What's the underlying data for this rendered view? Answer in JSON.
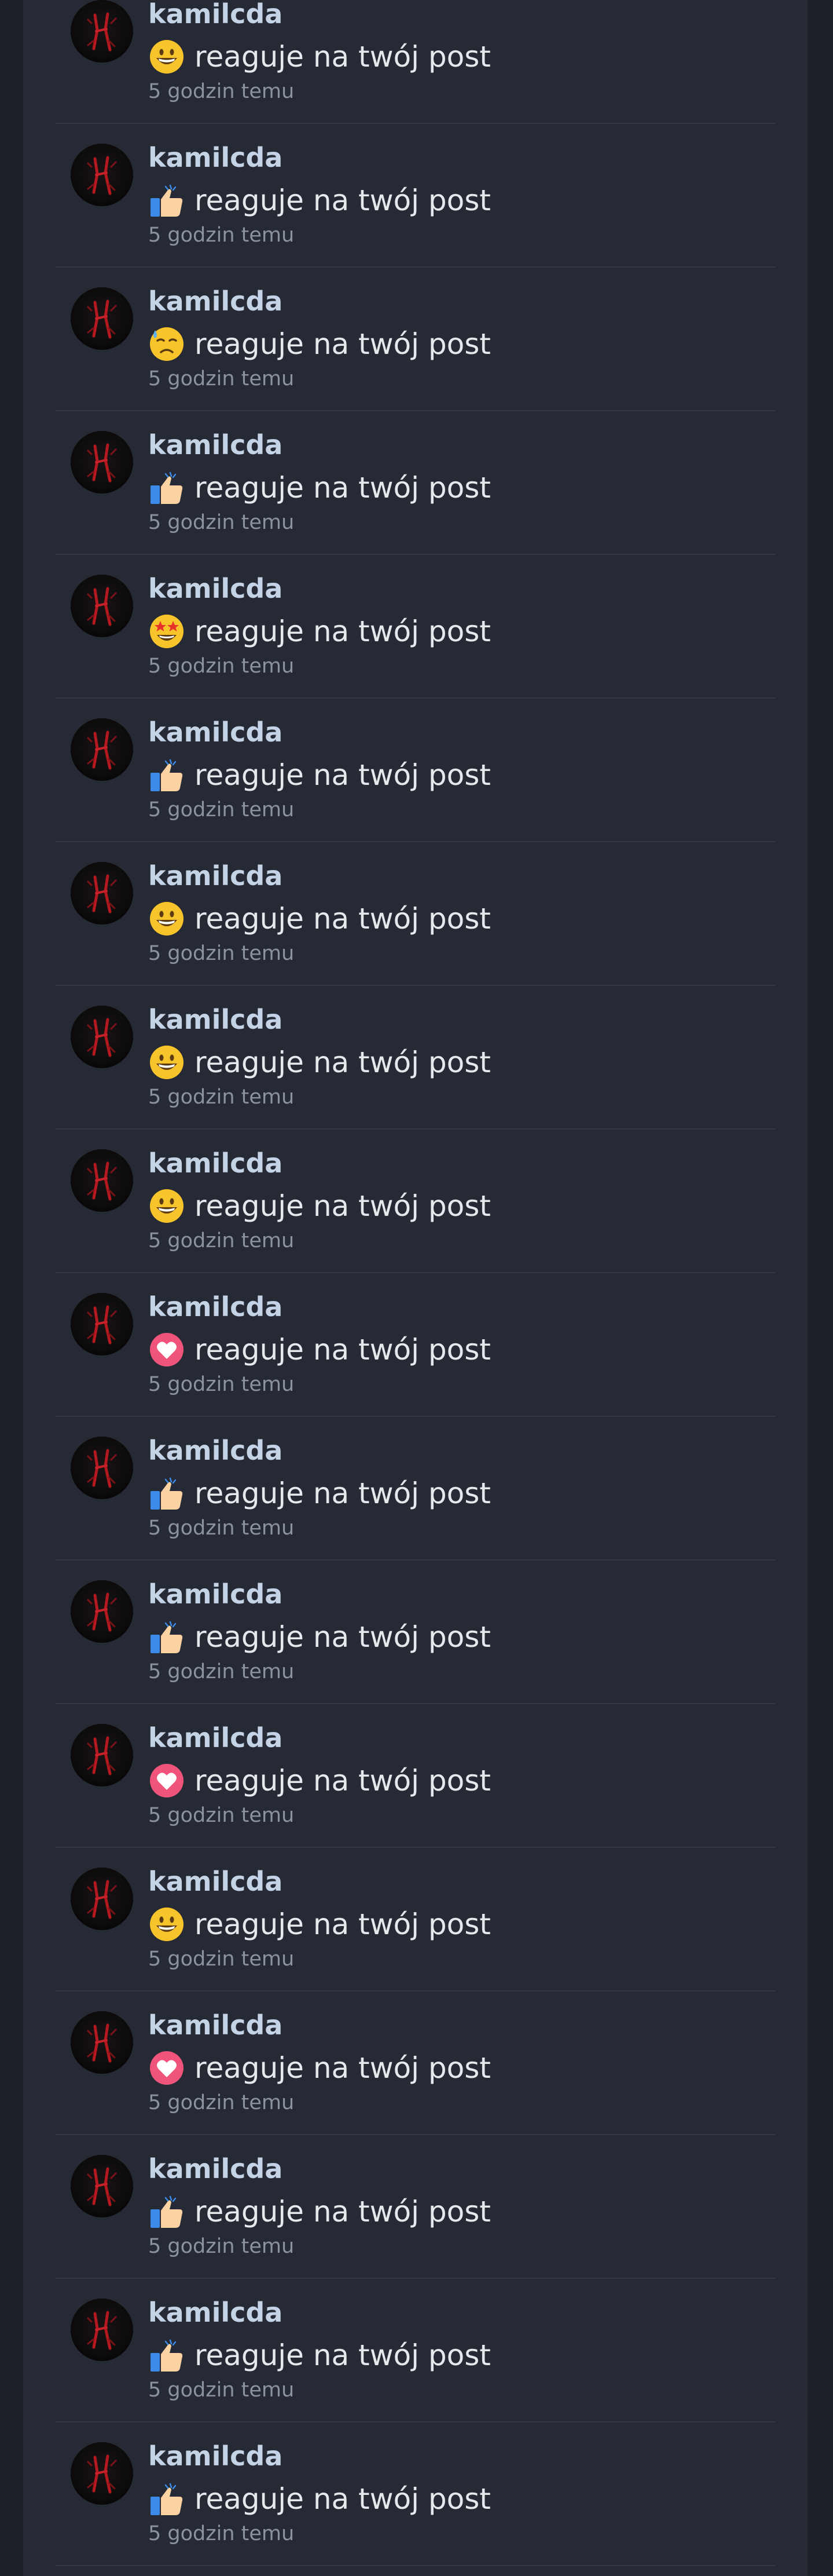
{
  "notifications": [
    {
      "user": "kamilcda",
      "reaction": "grinning-face-icon",
      "action": "reaguje na twój post",
      "time": "5 godzin temu"
    },
    {
      "user": "kamilcda",
      "reaction": "thumbs-up-icon",
      "action": "reaguje na twój post",
      "time": "5 godzin temu"
    },
    {
      "user": "kamilcda",
      "reaction": "sad-face-icon",
      "action": "reaguje na twój post",
      "time": "5 godzin temu"
    },
    {
      "user": "kamilcda",
      "reaction": "thumbs-up-icon",
      "action": "reaguje na twój post",
      "time": "5 godzin temu"
    },
    {
      "user": "kamilcda",
      "reaction": "star-struck-icon",
      "action": "reaguje na twój post",
      "time": "5 godzin temu"
    },
    {
      "user": "kamilcda",
      "reaction": "thumbs-up-icon",
      "action": "reaguje na twój post",
      "time": "5 godzin temu"
    },
    {
      "user": "kamilcda",
      "reaction": "grinning-face-icon",
      "action": "reaguje na twój post",
      "time": "5 godzin temu"
    },
    {
      "user": "kamilcda",
      "reaction": "grinning-face-icon",
      "action": "reaguje na twój post",
      "time": "5 godzin temu"
    },
    {
      "user": "kamilcda",
      "reaction": "grinning-face-icon",
      "action": "reaguje na twój post",
      "time": "5 godzin temu"
    },
    {
      "user": "kamilcda",
      "reaction": "heart-icon",
      "action": "reaguje na twój post",
      "time": "5 godzin temu"
    },
    {
      "user": "kamilcda",
      "reaction": "thumbs-up-icon",
      "action": "reaguje na twój post",
      "time": "5 godzin temu"
    },
    {
      "user": "kamilcda",
      "reaction": "thumbs-up-icon",
      "action": "reaguje na twój post",
      "time": "5 godzin temu"
    },
    {
      "user": "kamilcda",
      "reaction": "heart-icon",
      "action": "reaguje na twój post",
      "time": "5 godzin temu"
    },
    {
      "user": "kamilcda",
      "reaction": "grinning-face-icon",
      "action": "reaguje na twój post",
      "time": "5 godzin temu"
    },
    {
      "user": "kamilcda",
      "reaction": "heart-icon",
      "action": "reaguje na twój post",
      "time": "5 godzin temu"
    },
    {
      "user": "kamilcda",
      "reaction": "thumbs-up-icon",
      "action": "reaguje na twój post",
      "time": "5 godzin temu"
    },
    {
      "user": "kamilcda",
      "reaction": "thumbs-up-icon",
      "action": "reaguje na twój post",
      "time": "5 godzin temu"
    },
    {
      "user": "kamilcda",
      "reaction": "thumbs-up-icon",
      "action": "reaguje na twój post",
      "time": "5 godzin temu"
    }
  ],
  "colors": {
    "page_bg": "#1c2129",
    "panel_bg": "#252a34",
    "divider": "#343b47",
    "username": "#c5d3e6",
    "action_text": "#e6e8ec",
    "time_text": "#8b93a0"
  }
}
